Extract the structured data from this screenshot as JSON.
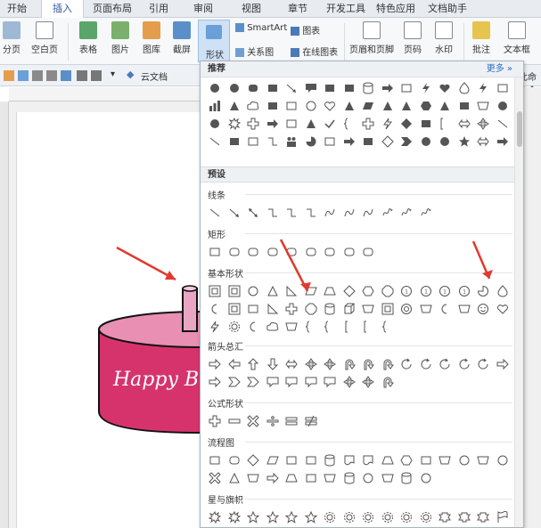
{
  "tabs": [
    "开始",
    "插入",
    "页面布局",
    "引用",
    "审阅",
    "视图",
    "章节",
    "开发工具",
    "特色应用",
    "文档助手"
  ],
  "ribbon": {
    "page_btn": "分页",
    "blank_btn": "空白页",
    "table_btn": "表格",
    "picture_btn": "图片",
    "gallery_btn": "图库",
    "screenshot_btn": "截屏",
    "shape_btn": "形状",
    "smartart": "SmartArt",
    "chart": "图表",
    "relation": "关系图",
    "online_chart": "在线图表",
    "header_footer": "页眉和页脚",
    "page_number": "页码",
    "watermark": "水印",
    "comment": "批注",
    "textbox": "文本框"
  },
  "quickbar": {
    "cloud_doc": "云文档",
    "right_text": "此命令今"
  },
  "document": {
    "cake_text": "Happy B"
  },
  "colors": {
    "accent": "#2b579a",
    "cake": "#d6336c",
    "cake_top": "#e88fb3",
    "candle": "#e8a6c4",
    "arrow": "#e03a2f"
  },
  "panel": {
    "recent_title": "推荐",
    "more_label": "更多",
    "preset_title": "预设",
    "categories": [
      "线条",
      "矩形",
      "基本形状",
      "箭头总汇",
      "公式形状",
      "流程图",
      "星与旗帜"
    ]
  }
}
